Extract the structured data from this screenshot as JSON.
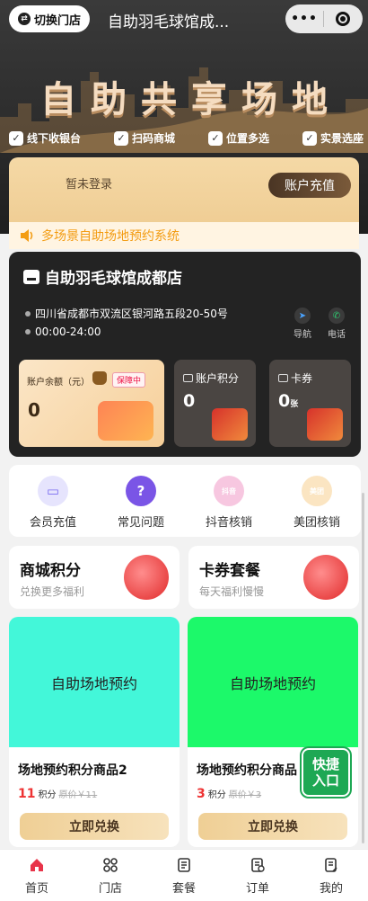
{
  "topbar": {
    "switch_label": "切换门店",
    "title": "自助羽毛球馆成...",
    "more_icon": "more-dots-icon",
    "close_icon": "target-close-icon"
  },
  "hero": {
    "title": "自助共享场地",
    "features": [
      "线下收银台",
      "扫码商城",
      "位置多选",
      "实景选座"
    ]
  },
  "member": {
    "login_text": "暂未登录",
    "recharge_label": "账户充值"
  },
  "notice": {
    "text": "多场景自助场地预约系统"
  },
  "store": {
    "name": "自助羽毛球馆成都店",
    "address": "四川省成都市双流区银河路五段20-50号",
    "hours": "00:00-24:00",
    "nav_label": "导航",
    "phone_label": "电话",
    "balance": {
      "label": "账户余额（元）",
      "safe": "保障中",
      "value": "0"
    },
    "points": {
      "label": "账户积分",
      "value": "0"
    },
    "coupons": {
      "label": "卡券",
      "value": "0",
      "unit": "张"
    }
  },
  "quick": [
    {
      "label": "会员充值",
      "icon": "member-card-icon",
      "glyph": "▭",
      "color": "#7a6cf0",
      "bg": "#e6e4fd"
    },
    {
      "label": "常见问题",
      "icon": "question-icon",
      "glyph": "?",
      "color": "#ffffff",
      "bg": "#7a55e6"
    },
    {
      "label": "抖音核销",
      "icon": "douyin-icon",
      "glyph": "抖音",
      "color": "#ffffff",
      "bg": "#f7c7e0"
    },
    {
      "label": "美团核销",
      "icon": "meituan-icon",
      "glyph": "美团",
      "color": "#ffffff",
      "bg": "#fbe5c2"
    }
  ],
  "promos": [
    {
      "title": "商城积分",
      "subtitle": "兑换更多福利"
    },
    {
      "title": "卡券套餐",
      "subtitle": "每天福利慢慢"
    }
  ],
  "products": [
    {
      "banner": "自助场地预约",
      "banner_color": "#43f7d9",
      "name": "场地预约积分商品2",
      "points": "11",
      "points_unit": "积分",
      "orig": "原价￥11",
      "button": "立即兑换"
    },
    {
      "banner": "自助场地预约",
      "banner_color": "#1cf96a",
      "name": "场地预约积分商品",
      "points": "3",
      "points_unit": "积分",
      "orig": "原价￥3",
      "button": "立即兑换"
    }
  ],
  "fast_entry": [
    "快捷",
    "入口"
  ],
  "tabs": [
    {
      "label": "首页",
      "icon": "home-icon",
      "active": true
    },
    {
      "label": "门店",
      "icon": "store-grid-icon",
      "active": false
    },
    {
      "label": "套餐",
      "icon": "package-list-icon",
      "active": false
    },
    {
      "label": "订单",
      "icon": "order-doc-icon",
      "active": false
    },
    {
      "label": "我的",
      "icon": "profile-doc-icon",
      "active": false
    }
  ],
  "colors": {
    "accent": "#f39c12",
    "price": "#e33333",
    "home_active": "#e8344a",
    "fast_entry": "#1ea854"
  }
}
